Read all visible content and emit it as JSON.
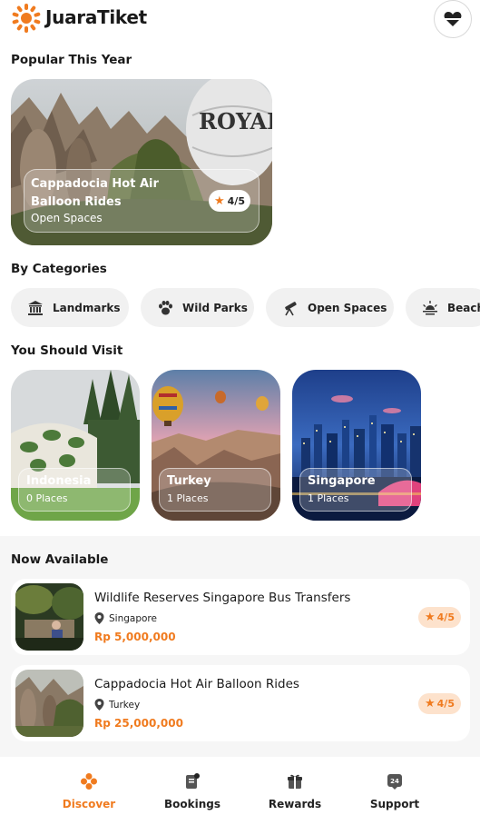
{
  "app": {
    "name": "JuaraTiket",
    "brand_color": "#f07b1f",
    "logo_icon": "sun-icon",
    "favorite_icon": "heart-icon"
  },
  "popular": {
    "section_title": "Popular This Year",
    "card": {
      "title": "Cappadocia Hot Air Balloon Rides",
      "category": "Open Spaces",
      "rating": "4/5",
      "balloon_text": "ROYAL"
    }
  },
  "categories": {
    "section_title": "By Categories",
    "items": [
      {
        "label": "Landmarks",
        "icon": "landmark-icon"
      },
      {
        "label": "Wild Parks",
        "icon": "paw-icon"
      },
      {
        "label": "Open Spaces",
        "icon": "telescope-icon"
      },
      {
        "label": "Beach",
        "icon": "sunset-icon"
      }
    ]
  },
  "visit": {
    "section_title": "You Should Visit",
    "items": [
      {
        "name": "Indonesia",
        "count": "0 Places"
      },
      {
        "name": "Turkey",
        "count": "1 Places"
      },
      {
        "name": "Singapore",
        "count": "1 Places"
      }
    ]
  },
  "available": {
    "section_title": "Now Available",
    "items": [
      {
        "title": "Wildlife Reserves Singapore Bus Transfers",
        "location": "Singapore",
        "price": "Rp 5,000,000",
        "rating": "4/5"
      },
      {
        "title": "Cappadocia Hot Air Balloon Rides",
        "location": "Turkey",
        "price": "Rp 25,000,000",
        "rating": "4/5"
      }
    ]
  },
  "nav": {
    "items": [
      {
        "label": "Discover",
        "icon": "discover-icon",
        "active": true
      },
      {
        "label": "Bookings",
        "icon": "ticket-icon",
        "active": false
      },
      {
        "label": "Rewards",
        "icon": "gift-icon",
        "active": false
      },
      {
        "label": "Support",
        "icon": "support-24-icon",
        "active": false
      }
    ],
    "support_badge": "24"
  }
}
